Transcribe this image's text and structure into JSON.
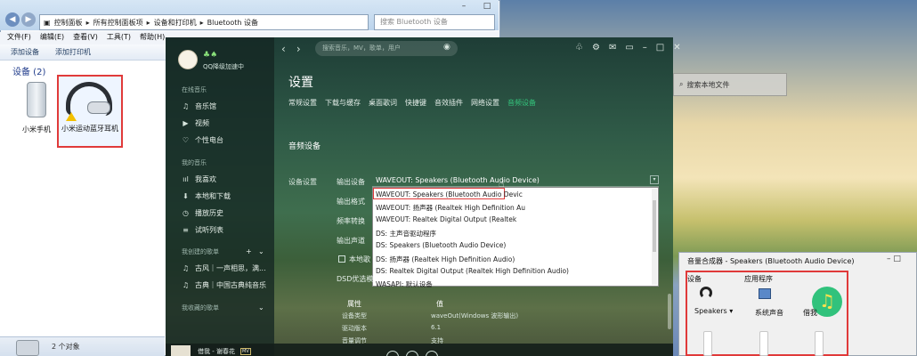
{
  "explorer": {
    "breadcrumb": [
      "控制面板",
      "所有控制面板项",
      "设备和打印机",
      "Bluetooth 设备"
    ],
    "search_placeholder": "搜索 Bluetooth 设备",
    "menu": [
      "文件(F)",
      "编辑(E)",
      "查看(V)",
      "工具(T)",
      "帮助(H)"
    ],
    "toolbar": [
      "添加设备",
      "添加打印机"
    ],
    "devices_header": "设备 (2)",
    "devices": [
      {
        "label": "小米手机",
        "icon": "phone-icon"
      },
      {
        "label": "小米运动蓝牙耳机",
        "icon": "headset-icon"
      }
    ],
    "status_text": "2 个对象"
  },
  "desktop_search": {
    "placeholder": "搜索本地文件"
  },
  "mixer": {
    "title": "音量合成器 - Speakers (Bluetooth Audio Device)",
    "device_header": "设备",
    "apps_header": "应用程序",
    "device_label": "Speakers",
    "system_label": "系统声音",
    "app_label": "借我"
  },
  "qq": {
    "username": "QQ降级加速中",
    "sections": {
      "online": "在线音乐",
      "mine": "我的音乐",
      "created": "我创建的歌单",
      "collected": "我收藏的歌单"
    },
    "online_items": [
      "音乐馆",
      "视频",
      "个性电台"
    ],
    "mine_items": [
      "我喜欢",
      "本地和下载",
      "播放历史",
      "试听列表"
    ],
    "created_items": [
      "古风｜一声相思，满...",
      "古典｜中国古典纯音乐"
    ],
    "search_placeholder": "搜索音乐，MV，歌单，用户",
    "settings_title": "设置",
    "tabs": [
      "常规设置",
      "下载与缓存",
      "桌面歌词",
      "快捷键",
      "音效插件",
      "网络设置",
      "音频设备"
    ],
    "active_tab": "音频设备",
    "section_title": "音频设备",
    "audio_label": "设备设置",
    "rows": [
      "输出设备",
      "输出格式",
      "频率转换",
      "输出声道"
    ],
    "output_value": "WAVEOUT: Speakers (Bluetooth Audio Device)",
    "dropdown_options": [
      "WAVEOUT: Speakers (Bluetooth Audio Devic",
      "WAVEOUT: 扬声器 (Realtek High Definition Au",
      "WAVEOUT: Realtek Digital Output (Realtek",
      "DS: 主声音驱动程序",
      "DS: Speakers (Bluetooth Audio Device)",
      "DS: 扬声器 (Realtek High Definition Audio)",
      "DS: Realtek Digital Output (Realtek High Definition Audio)",
      "WASAPI: 默认设备"
    ],
    "checkbox_label": "本地歌",
    "dsd_label": "DSD优选模",
    "info_headers": {
      "key": "属性",
      "value": "值"
    },
    "info": [
      {
        "key": "设备类型",
        "value": "waveOut(Windows 波形输出)"
      },
      {
        "key": "驱动版本",
        "value": "6.1"
      },
      {
        "key": "音量调节",
        "value": "支持"
      }
    ],
    "player_song": "借我 - 谢春花",
    "player_badge": "MV"
  },
  "colors": {
    "accent_green": "#34c47c",
    "highlight_red": "#e03a3a"
  }
}
